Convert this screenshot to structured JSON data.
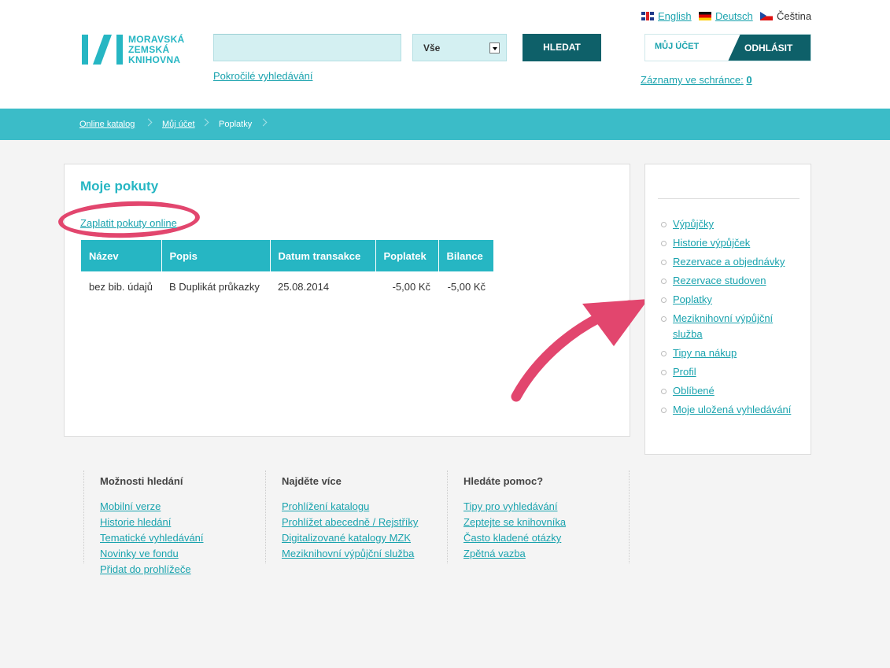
{
  "logo": {
    "lines": [
      "MORAVSKÁ",
      "ZEMSKÁ",
      "KNIHOVNA"
    ]
  },
  "search": {
    "value": "",
    "placeholder": "",
    "scope": "Vše",
    "button": "HLEDAT",
    "advanced": "Pokročilé vyhledávání"
  },
  "languages": {
    "en": "English",
    "de": "Deutsch",
    "cs": "Čeština"
  },
  "account": {
    "my_account": "MŮJ ÚČET",
    "logout": "ODHLÁSIT",
    "cart_label": "Záznamy ve schránce:",
    "cart_count": "0"
  },
  "breadcrumb": [
    "Online katalog",
    "Můj účet",
    "Poplatky"
  ],
  "main": {
    "title": "Moje pokuty",
    "pay_link": "Zaplatit pokuty online",
    "table": {
      "headers": [
        "Název",
        "Popis",
        "Datum transakce",
        "Poplatek",
        "Bilance"
      ],
      "rows": [
        [
          "bez bib. údajů",
          "B Duplikát průkazky",
          "25.08.2014",
          "-5,00 Kč",
          "-5,00 Kč"
        ]
      ]
    }
  },
  "sidebar": {
    "items": [
      "Výpůjčky",
      "Historie výpůjček",
      "Rezervace a objednávky",
      "Rezervace studoven",
      "Poplatky",
      "Meziknihovní výpůjční služba",
      "Tipy na nákup",
      "Profil",
      "Oblíbené",
      "Moje uložená vyhledávání"
    ]
  },
  "footer": [
    {
      "title": "Možnosti hledání",
      "links": [
        "Mobilní verze",
        "Historie hledání",
        "Tematické vyhledávání",
        "Novinky ve fondu",
        "Přidat do prohlížeče"
      ]
    },
    {
      "title": "Najděte více",
      "links": [
        "Prohlížení katalogu",
        "Prohlížet abecedně / Rejstříky",
        "Digitalizované katalogy MZK",
        "Meziknihovní výpůjční služba"
      ]
    },
    {
      "title": "Hledáte pomoc?",
      "links": [
        "Tipy pro vyhledávání",
        "Zeptejte se knihovníka",
        "Často kladené otázky",
        "Zpětná vazba"
      ]
    }
  ],
  "colors": {
    "accent": "#26b6c3",
    "dark": "#0e6069",
    "highlight": "#e2466e"
  }
}
